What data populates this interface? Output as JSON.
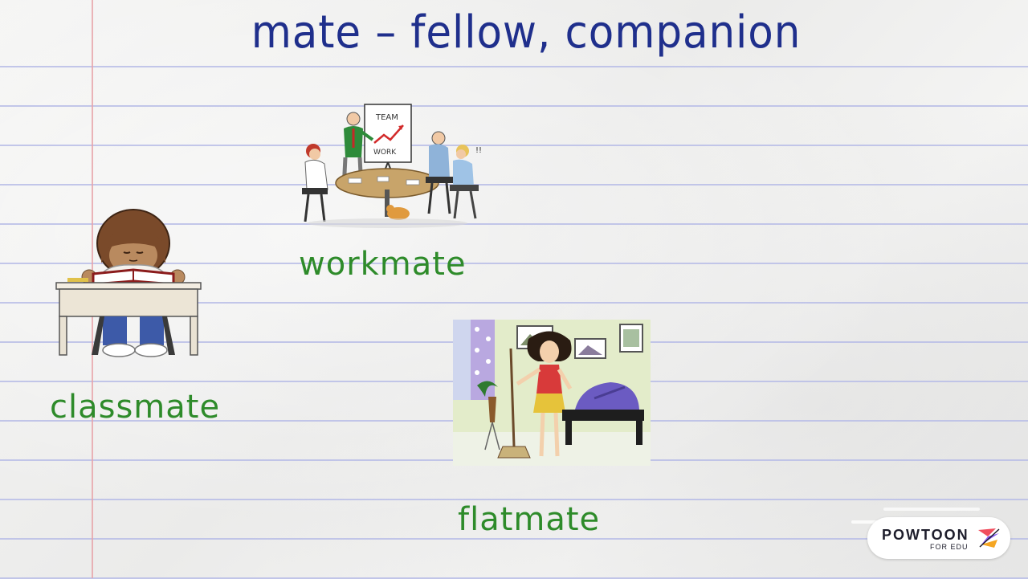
{
  "title": "mate – fellow, companion",
  "words": {
    "classmate": "classmate",
    "workmate": "workmate",
    "flatmate": "flatmate"
  },
  "illustration_text": {
    "board_top": "TEAM",
    "board_bottom": "WORK"
  },
  "logo": {
    "name": "POWTOON",
    "sub": "FOR EDU"
  },
  "colors": {
    "title": "#1f2f8c",
    "words": "#2e8b2a",
    "ruled_lines": "#b9bde6",
    "margin_line": "#e7a3a8"
  }
}
